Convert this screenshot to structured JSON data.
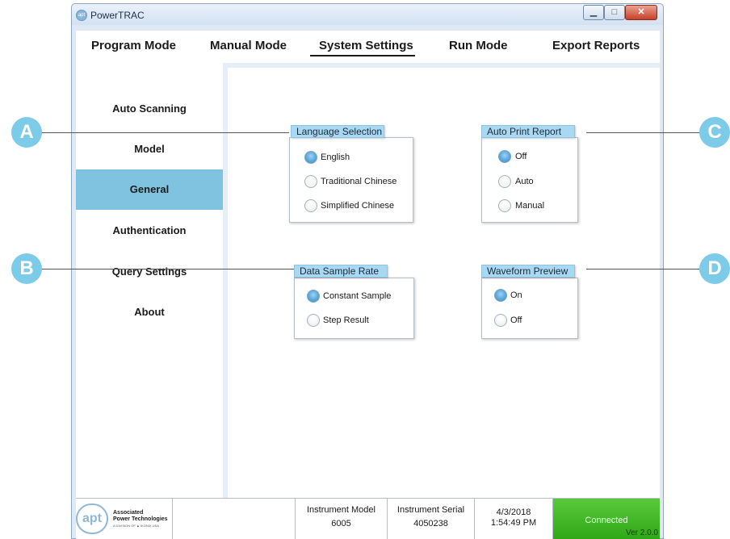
{
  "window": {
    "title": "PowerTRAC",
    "app_icon": "apt",
    "buttons": [
      "minimize-icon",
      "maximize-icon",
      "close-icon"
    ]
  },
  "menu": {
    "items": [
      {
        "label": "Program Mode"
      },
      {
        "label": "Manual Mode"
      },
      {
        "label": "System Settings",
        "active": true
      },
      {
        "label": "Run Mode"
      },
      {
        "label": "Export Reports"
      }
    ]
  },
  "sidebar": {
    "items": [
      {
        "label": "Auto Scanning"
      },
      {
        "label": "Model"
      },
      {
        "label": "General",
        "active": true
      },
      {
        "label": "Authentication"
      },
      {
        "label": "Query Settings"
      },
      {
        "label": "About"
      }
    ],
    "active_color": "#7fc3e0"
  },
  "groups": {
    "language": {
      "title": "Language Selection",
      "options": [
        "English",
        "Traditional Chinese",
        "Simplified Chinese"
      ],
      "selected": "English"
    },
    "auto_print": {
      "title": "Auto Print Report",
      "options": [
        "Off",
        "Auto",
        "Manual"
      ],
      "selected": "Off"
    },
    "sample_rate": {
      "title": "Data Sample Rate",
      "options": [
        "Constant Sample",
        "Step Result"
      ],
      "selected": "Constant Sample"
    },
    "waveform": {
      "title": "Waveform Preview",
      "options": [
        "On",
        "Off"
      ],
      "selected": "On"
    }
  },
  "status": {
    "logo_text": "apt",
    "company_line1": "Associated",
    "company_line2": "Power Technologies",
    "company_line3": "A DIVISION OF ▲ IKONIX USA",
    "model_label": "Instrument Model",
    "model_value": "6005",
    "serial_label": "Instrument Serial",
    "serial_value": "4050238",
    "date": "4/3/2018",
    "time": "1:54:49 PM",
    "connection": "Connected",
    "version": "Ver 2.0.0"
  },
  "callouts": [
    "A",
    "B",
    "C",
    "D"
  ],
  "colors": {
    "accent": "#7fc3e0",
    "callout": "#7ccbe8",
    "connected": "#3cb424",
    "group_tab": "#a9d8f3"
  }
}
